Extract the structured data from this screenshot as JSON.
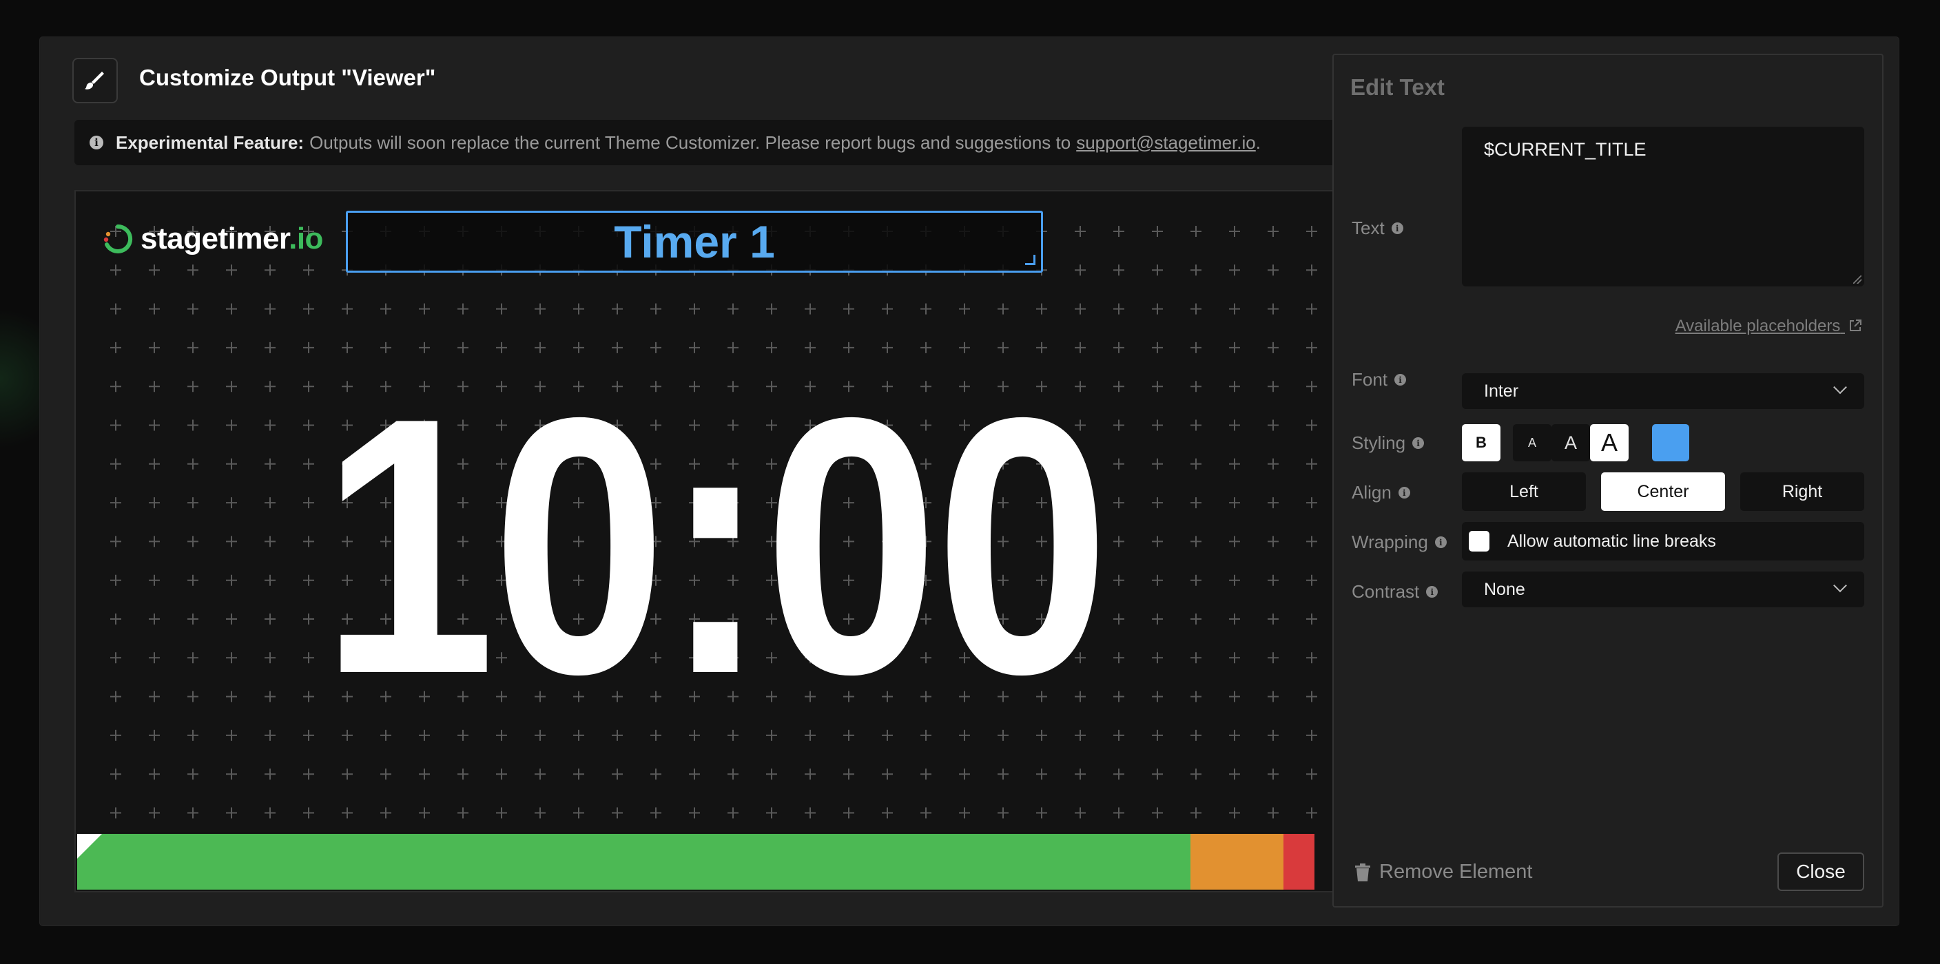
{
  "modal": {
    "title": "Customize Output \"Viewer\"",
    "notice_label": "Experimental Feature:",
    "notice_text": "Outputs will soon replace the current Theme Customizer. Please report bugs and suggestions to",
    "notice_email": "support@stagetimer.io",
    "notice_end": "."
  },
  "canvas": {
    "logo_name": "stagetimer",
    "logo_tld": ".io",
    "title_element": "Timer 1",
    "clock": "10:00",
    "progress": {
      "green_fraction": 0.9,
      "orange_fraction": 0.075,
      "red_fraction": 0.025,
      "colors": {
        "green": "#4cb954",
        "orange": "#e29130",
        "red": "#d93a3c"
      }
    }
  },
  "panel": {
    "title": "Edit Text",
    "text_label": "Text",
    "text_value": "$CURRENT_TITLE",
    "placeholders_link": "Available placeholders",
    "font_label": "Font",
    "font_value": "Inter",
    "styling_label": "Styling",
    "bold_label": "B",
    "size_small": "A",
    "size_medium": "A",
    "size_large": "A",
    "color_swatch": "#4a9ff0",
    "align_label": "Align",
    "align_left": "Left",
    "align_center": "Center",
    "align_right": "Right",
    "align_selected": "Center",
    "wrapping_label": "Wrapping",
    "wrapping_text": "Allow automatic line breaks",
    "wrapping_checked": false,
    "contrast_label": "Contrast",
    "contrast_value": "None",
    "remove_label": "Remove Element",
    "close_label": "Close"
  },
  "icons": {
    "header": "paint-brush-icon",
    "info": "info-icon",
    "external": "external-link-icon",
    "chevron": "chevron-down-icon",
    "trash": "trash-icon"
  }
}
